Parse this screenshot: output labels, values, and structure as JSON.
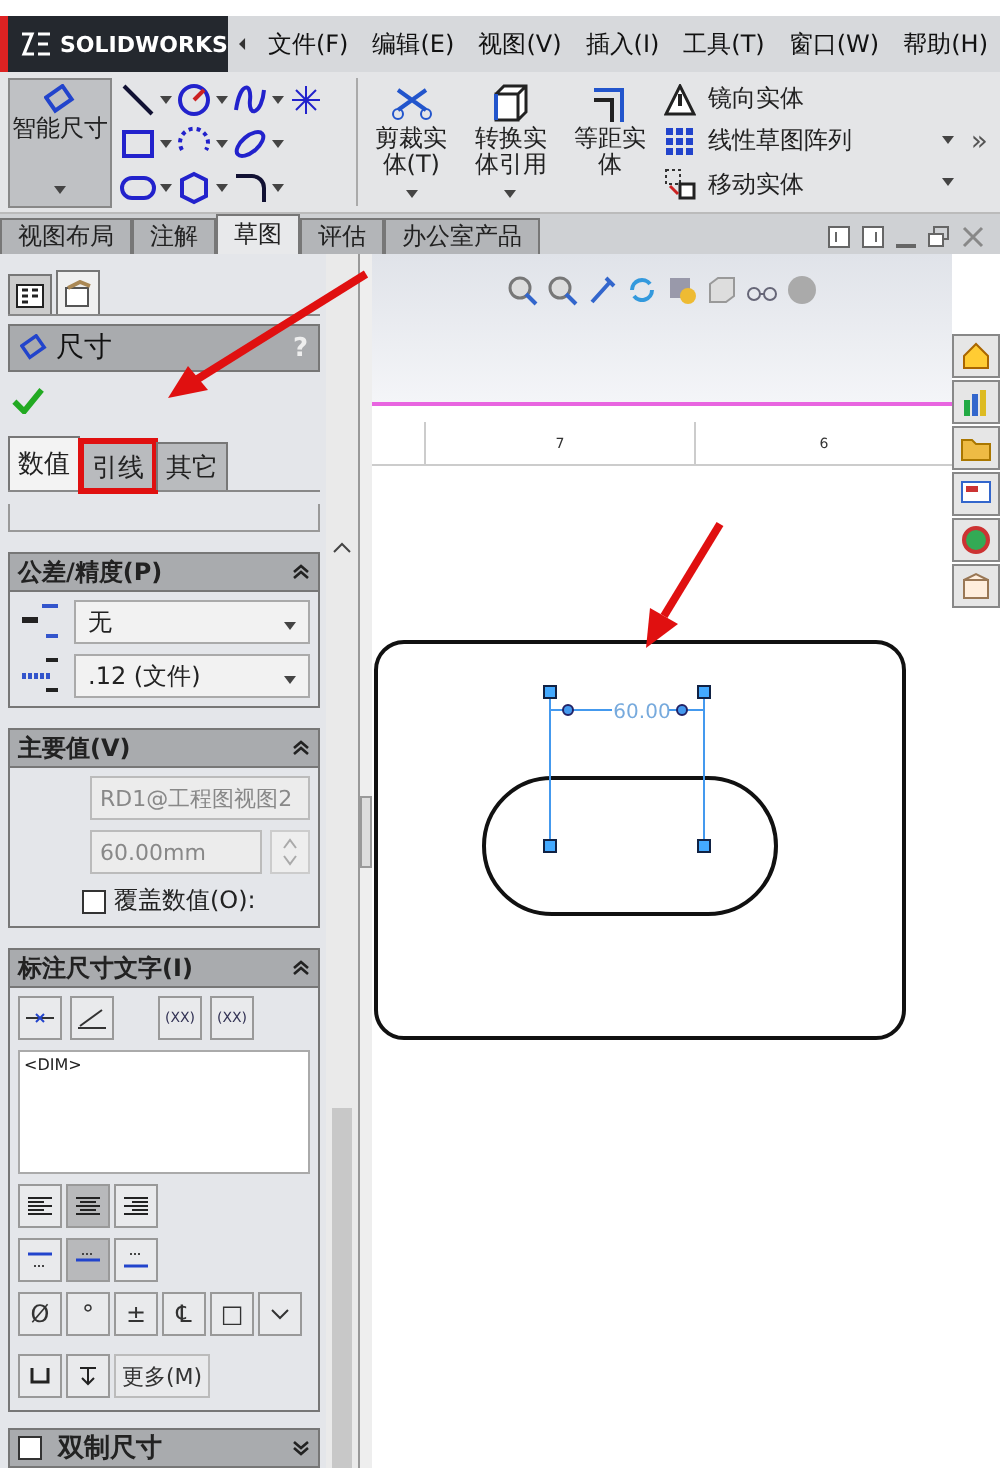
{
  "app": {
    "logo": "SOLIDWORKS"
  },
  "menu": [
    "文件(F)",
    "编辑(E)",
    "视图(V)",
    "插入(I)",
    "工具(T)",
    "窗口(W)",
    "帮助(H)"
  ],
  "toolbar": {
    "smart_dimension": "智能尺寸",
    "tools": [
      {
        "kind": "trim",
        "label": "剪裁实体(T)"
      },
      {
        "kind": "convert",
        "label": "转换实体引用"
      },
      {
        "kind": "offset",
        "label": "等距实体"
      }
    ],
    "list": [
      {
        "kind": "mirror",
        "label": "镜向实体",
        "dropdown": false
      },
      {
        "kind": "pattern",
        "label": "线性草图阵列",
        "dropdown": true
      },
      {
        "kind": "move",
        "label": "移动实体",
        "dropdown": true
      }
    ],
    "more": "»"
  },
  "command_tabs": [
    {
      "label": "视图布局",
      "selected": false
    },
    {
      "label": "注解",
      "selected": false
    },
    {
      "label": "草图",
      "selected": true
    },
    {
      "label": "评估",
      "selected": false
    },
    {
      "label": "办公室产品",
      "selected": false
    }
  ],
  "panel": {
    "title": "尺寸",
    "help": "?",
    "tabs": [
      {
        "label": "数值",
        "selected": true,
        "highlighted": false
      },
      {
        "label": "引线",
        "selected": false,
        "highlighted": true
      },
      {
        "label": "其它",
        "selected": false,
        "highlighted": false
      }
    ],
    "tolerance": {
      "title": "公差/精度(P)",
      "type": "无",
      "precision": ".12 (文件)"
    },
    "primary": {
      "title": "主要值(V)",
      "reference": "RD1@工程图视图2",
      "value": "60.00mm",
      "override": {
        "label": "覆盖数值(O):",
        "checked": false
      }
    },
    "dim_text": {
      "title": "标注尺寸文字(I)",
      "paren_buttons": [
        "(XX)",
        "(XX)"
      ],
      "text": "<DIM>",
      "align": [
        {
          "selected": false
        },
        {
          "selected": true
        },
        {
          "selected": false
        }
      ],
      "position": [
        {
          "selected": false
        },
        {
          "selected": true
        },
        {
          "selected": false
        }
      ],
      "symbols": [
        "Ø",
        "°",
        "±",
        "℄",
        "□"
      ],
      "more": "更多(M)"
    },
    "dual": {
      "title": "双制尺寸",
      "checked": false
    }
  },
  "ruler": [
    "7",
    "6"
  ],
  "drawing": {
    "dimension": "60.00"
  }
}
